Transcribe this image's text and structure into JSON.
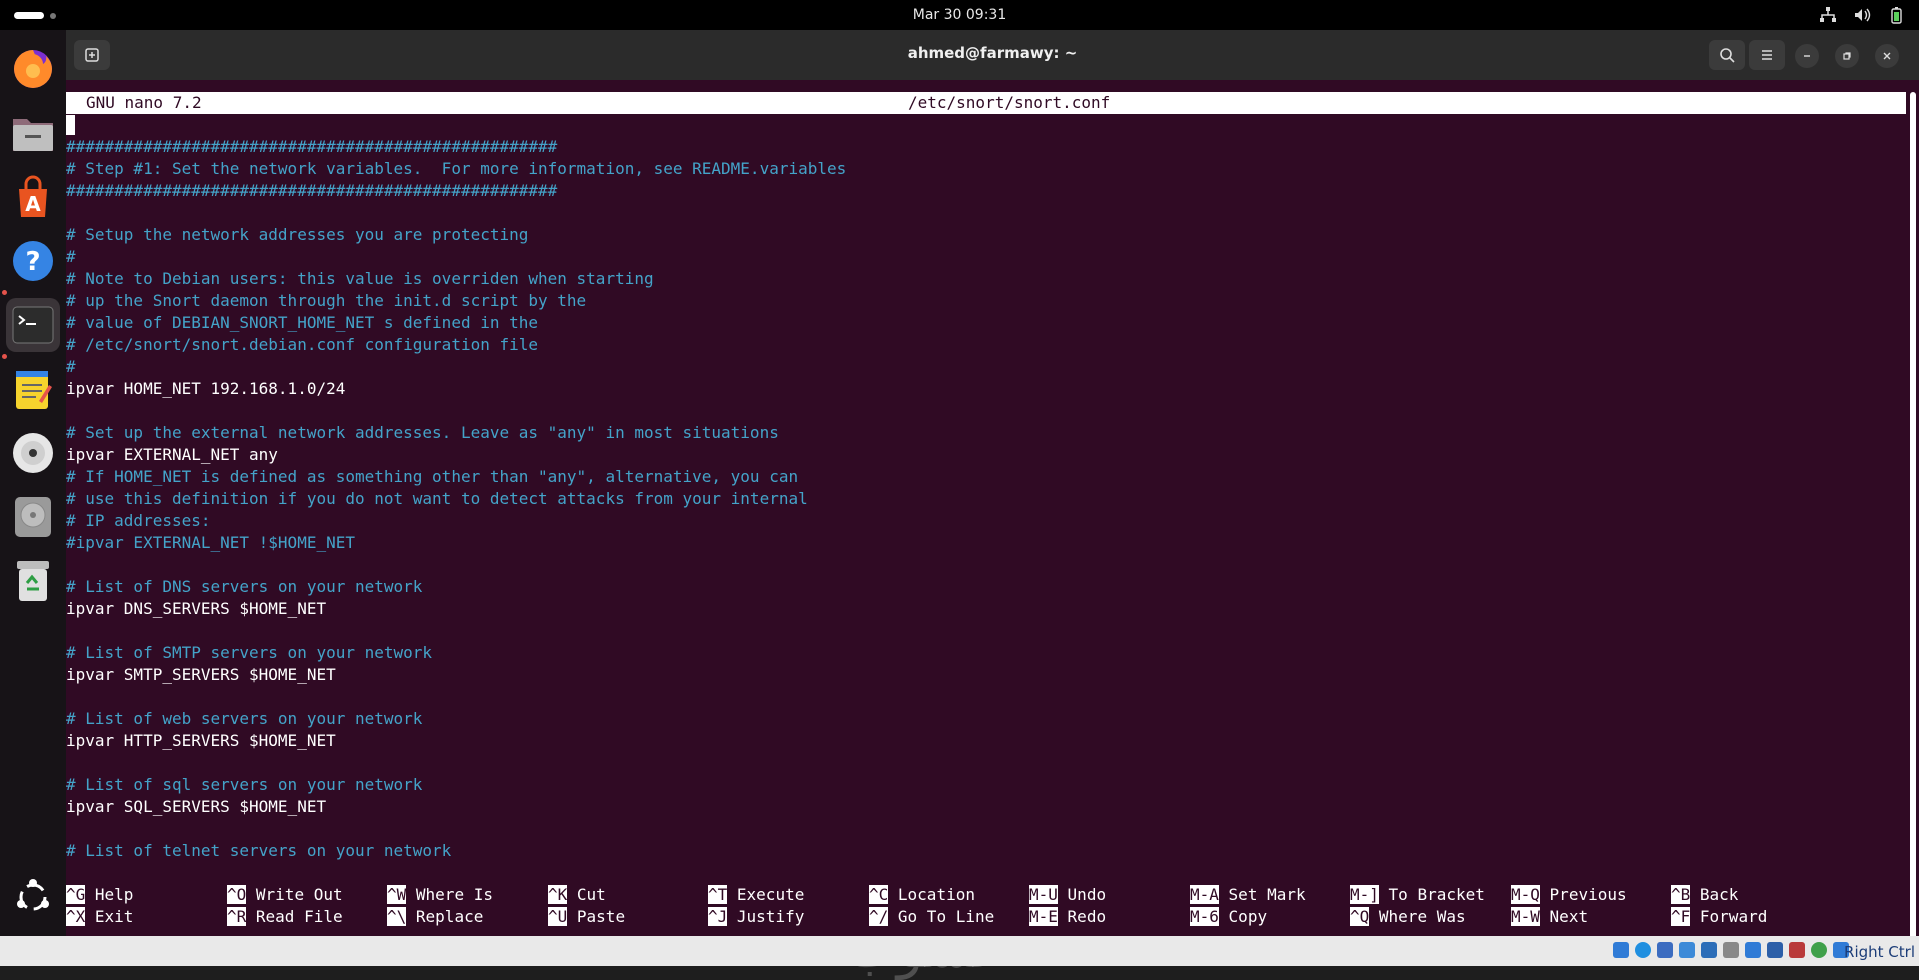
{
  "topbar": {
    "clock": "Mar 30  09:31",
    "tray_icons": [
      "network-icon",
      "volume-icon",
      "battery-icon"
    ]
  },
  "dock": {
    "apps": [
      {
        "name": "firefox",
        "running": false
      },
      {
        "name": "files",
        "running": false
      },
      {
        "name": "app-center",
        "running": false
      },
      {
        "name": "help",
        "running": false
      },
      {
        "name": "terminal",
        "running": true,
        "active": true
      },
      {
        "name": "text-editor",
        "running": true
      },
      {
        "name": "disc",
        "running": false
      },
      {
        "name": "disk-utility",
        "running": false
      },
      {
        "name": "trash",
        "running": false
      }
    ],
    "show_apps": "ubuntu-icon"
  },
  "window": {
    "title": "ahmed@farmawy: ~"
  },
  "nano": {
    "version": "GNU nano 7.2",
    "filename": "/etc/snort/snort.conf",
    "lines": [
      {
        "text": "",
        "kind": "text"
      },
      {
        "text": "###################################################",
        "kind": "comment"
      },
      {
        "text": "# Step #1: Set the network variables.  For more information, see README.variables",
        "kind": "comment"
      },
      {
        "text": "###################################################",
        "kind": "comment"
      },
      {
        "text": "",
        "kind": "text"
      },
      {
        "text": "# Setup the network addresses you are protecting",
        "kind": "comment"
      },
      {
        "text": "#",
        "kind": "comment"
      },
      {
        "text": "# Note to Debian users: this value is overriden when starting",
        "kind": "comment"
      },
      {
        "text": "# up the Snort daemon through the init.d script by the",
        "kind": "comment"
      },
      {
        "text": "# value of DEBIAN_SNORT_HOME_NET s defined in the",
        "kind": "comment"
      },
      {
        "text": "# /etc/snort/snort.debian.conf configuration file",
        "kind": "comment"
      },
      {
        "text": "#",
        "kind": "comment"
      },
      {
        "text": "ipvar HOME_NET 192.168.1.0/24",
        "kind": "text"
      },
      {
        "text": "",
        "kind": "text"
      },
      {
        "text": "# Set up the external network addresses. Leave as \"any\" in most situations",
        "kind": "comment"
      },
      {
        "text": "ipvar EXTERNAL_NET any",
        "kind": "text"
      },
      {
        "text": "# If HOME_NET is defined as something other than \"any\", alternative, you can",
        "kind": "comment"
      },
      {
        "text": "# use this definition if you do not want to detect attacks from your internal",
        "kind": "comment"
      },
      {
        "text": "# IP addresses:",
        "kind": "comment"
      },
      {
        "text": "#ipvar EXTERNAL_NET !$HOME_NET",
        "kind": "comment"
      },
      {
        "text": "",
        "kind": "text"
      },
      {
        "text": "# List of DNS servers on your network",
        "kind": "comment"
      },
      {
        "text": "ipvar DNS_SERVERS $HOME_NET",
        "kind": "text"
      },
      {
        "text": "",
        "kind": "text"
      },
      {
        "text": "# List of SMTP servers on your network",
        "kind": "comment"
      },
      {
        "text": "ipvar SMTP_SERVERS $HOME_NET",
        "kind": "text"
      },
      {
        "text": "",
        "kind": "text"
      },
      {
        "text": "# List of web servers on your network",
        "kind": "comment"
      },
      {
        "text": "ipvar HTTP_SERVERS $HOME_NET",
        "kind": "text"
      },
      {
        "text": "",
        "kind": "text"
      },
      {
        "text": "# List of sql servers on your network",
        "kind": "comment"
      },
      {
        "text": "ipvar SQL_SERVERS $HOME_NET",
        "kind": "text"
      },
      {
        "text": "",
        "kind": "text"
      },
      {
        "text": "# List of telnet servers on your network",
        "kind": "comment"
      }
    ],
    "shortcuts_row1": [
      {
        "key": "^G",
        "label": "Help"
      },
      {
        "key": "^O",
        "label": "Write Out"
      },
      {
        "key": "^W",
        "label": "Where Is"
      },
      {
        "key": "^K",
        "label": "Cut"
      },
      {
        "key": "^T",
        "label": "Execute"
      },
      {
        "key": "^C",
        "label": "Location"
      },
      {
        "key": "M-U",
        "label": "Undo"
      },
      {
        "key": "M-A",
        "label": "Set Mark"
      },
      {
        "key": "M-]",
        "label": "To Bracket"
      },
      {
        "key": "M-Q",
        "label": "Previous"
      },
      {
        "key": "^B",
        "label": "Back"
      }
    ],
    "shortcuts_row2": [
      {
        "key": "^X",
        "label": "Exit"
      },
      {
        "key": "^R",
        "label": "Read File"
      },
      {
        "key": "^\\",
        "label": "Replace"
      },
      {
        "key": "^U",
        "label": "Paste"
      },
      {
        "key": "^J",
        "label": "Justify"
      },
      {
        "key": "^/",
        "label": "Go To Line"
      },
      {
        "key": "M-E",
        "label": "Redo"
      },
      {
        "key": "M-6",
        "label": "Copy"
      },
      {
        "key": "^Q",
        "label": "Where Was"
      },
      {
        "key": "M-W",
        "label": "Next"
      },
      {
        "key": "^F",
        "label": "Forward"
      }
    ]
  },
  "vbox": {
    "host_key": "Right Ctrl"
  },
  "colors": {
    "terminal_bg": "#300a24",
    "comment": "#44a3c9",
    "text": "#ffffff"
  }
}
